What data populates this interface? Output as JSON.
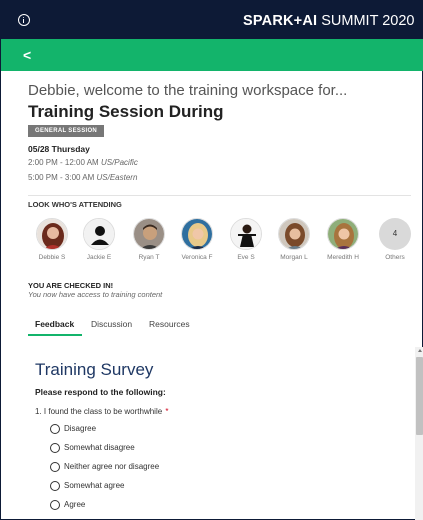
{
  "topbar": {
    "info_icon": "info-circle-icon",
    "brand_strong": "SPARK+AI",
    "brand_rest": "SUMMIT 2020"
  },
  "nav": {
    "back_icon": "chevron-left-icon",
    "back_glyph": "<"
  },
  "session": {
    "welcome": "Debbie, welcome to the training workspace for...",
    "title": "Training Session During",
    "badge": "GENERAL SESSION",
    "date": "05/28 Thursday",
    "time_1": "2:00 PM - 12:00 AM",
    "zone_1": "US/Pacific",
    "time_2": "5:00 PM - 3:00 AM",
    "zone_2": "US/Eastern"
  },
  "attending": {
    "label": "LOOK WHO'S ATTENDING",
    "attendees": [
      {
        "name": "Debbie S"
      },
      {
        "name": "Jackie E"
      },
      {
        "name": "Ryan T"
      },
      {
        "name": "Veronica F"
      },
      {
        "name": "Eve S"
      },
      {
        "name": "Morgan L"
      },
      {
        "name": "Meredith H"
      }
    ],
    "others_count": "4",
    "others_label": "Others"
  },
  "checkin": {
    "title": "YOU ARE CHECKED IN!",
    "subtitle": "You now have access to training content"
  },
  "tabs": {
    "active": "Feedback",
    "items": [
      {
        "label": "Feedback"
      },
      {
        "label": "Discussion"
      },
      {
        "label": "Resources"
      }
    ]
  },
  "survey": {
    "title": "Training Survey",
    "instruction": "Please respond to the following:",
    "question": "1. I found the class to be worthwhile",
    "required_mark": "*",
    "options": [
      {
        "label": "Disagree"
      },
      {
        "label": "Somewhat disagree"
      },
      {
        "label": "Neither agree nor disagree"
      },
      {
        "label": "Somewhat agree"
      },
      {
        "label": "Agree"
      }
    ]
  },
  "colors": {
    "topbar": "#0d1a36",
    "accent_green": "#13b46b",
    "survey_title": "#1f3864",
    "badge": "#777777",
    "required": "#d0021b"
  }
}
